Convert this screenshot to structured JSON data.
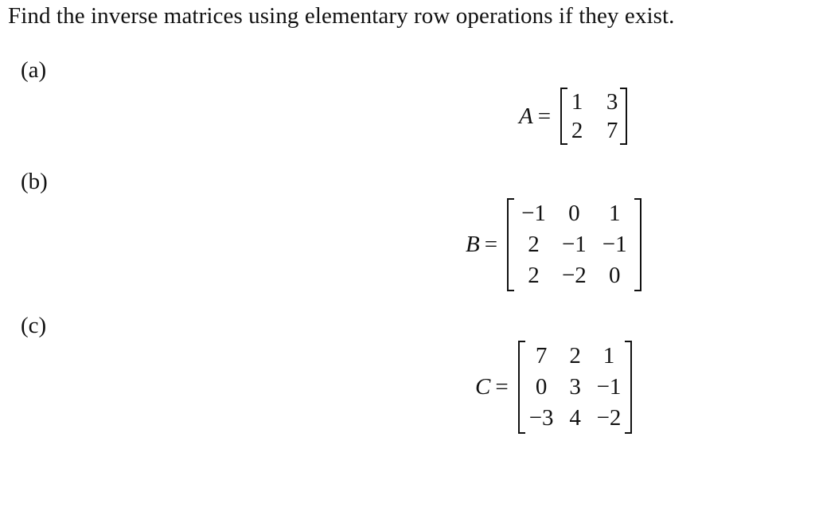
{
  "instruction": "Find the inverse matrices using elementary row operations if they exist.",
  "parts": [
    {
      "label": "(a)",
      "name": "A",
      "equals": "=",
      "matrix": [
        [
          "1",
          "3"
        ],
        [
          "2",
          "7"
        ]
      ]
    },
    {
      "label": "(b)",
      "name": "B",
      "equals": "=",
      "matrix": [
        [
          "−1",
          "0",
          "1"
        ],
        [
          "2",
          "−1",
          "−1"
        ],
        [
          "2",
          "−2",
          "0"
        ]
      ]
    },
    {
      "label": "(c)",
      "name": "C",
      "equals": "=",
      "matrix": [
        [
          "7",
          "2",
          "1"
        ],
        [
          "0",
          "3",
          "−1"
        ],
        [
          "−3",
          "4",
          "−2"
        ]
      ]
    }
  ]
}
